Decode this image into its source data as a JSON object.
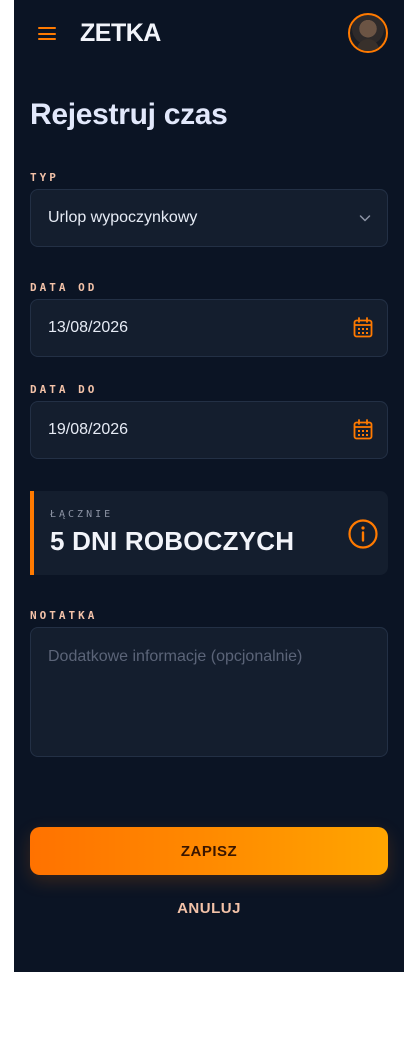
{
  "header": {
    "brand": "ZETKA",
    "menu_icon": "hamburger-menu-icon",
    "avatar_icon": "user-avatar"
  },
  "page": {
    "title": "Rejestruj czas"
  },
  "form": {
    "type": {
      "label": "TYP",
      "value": "Urlop wypoczynkowy",
      "icon": "chevron-down-icon"
    },
    "date_from": {
      "label": "DATA OD",
      "value": "13/08/2026",
      "icon": "calendar-icon"
    },
    "date_to": {
      "label": "DATA DO",
      "value": "19/08/2026",
      "icon": "calendar-icon"
    },
    "summary": {
      "label": "ŁĄCZNIE",
      "value": "5 DNI ROBOCZYCH",
      "icon": "info-icon"
    },
    "note": {
      "label": "NOTATKA",
      "placeholder": "Dodatkowe informacje (opcjonalnie)",
      "value": ""
    }
  },
  "actions": {
    "save_label": "ZAPISZ",
    "cancel_label": "ANULUJ"
  },
  "colors": {
    "background": "#0b1424",
    "surface": "#141e2e",
    "accent": "#ff7a00",
    "accent_gradient_end": "#ffa500",
    "label": "#f3c2a8"
  }
}
